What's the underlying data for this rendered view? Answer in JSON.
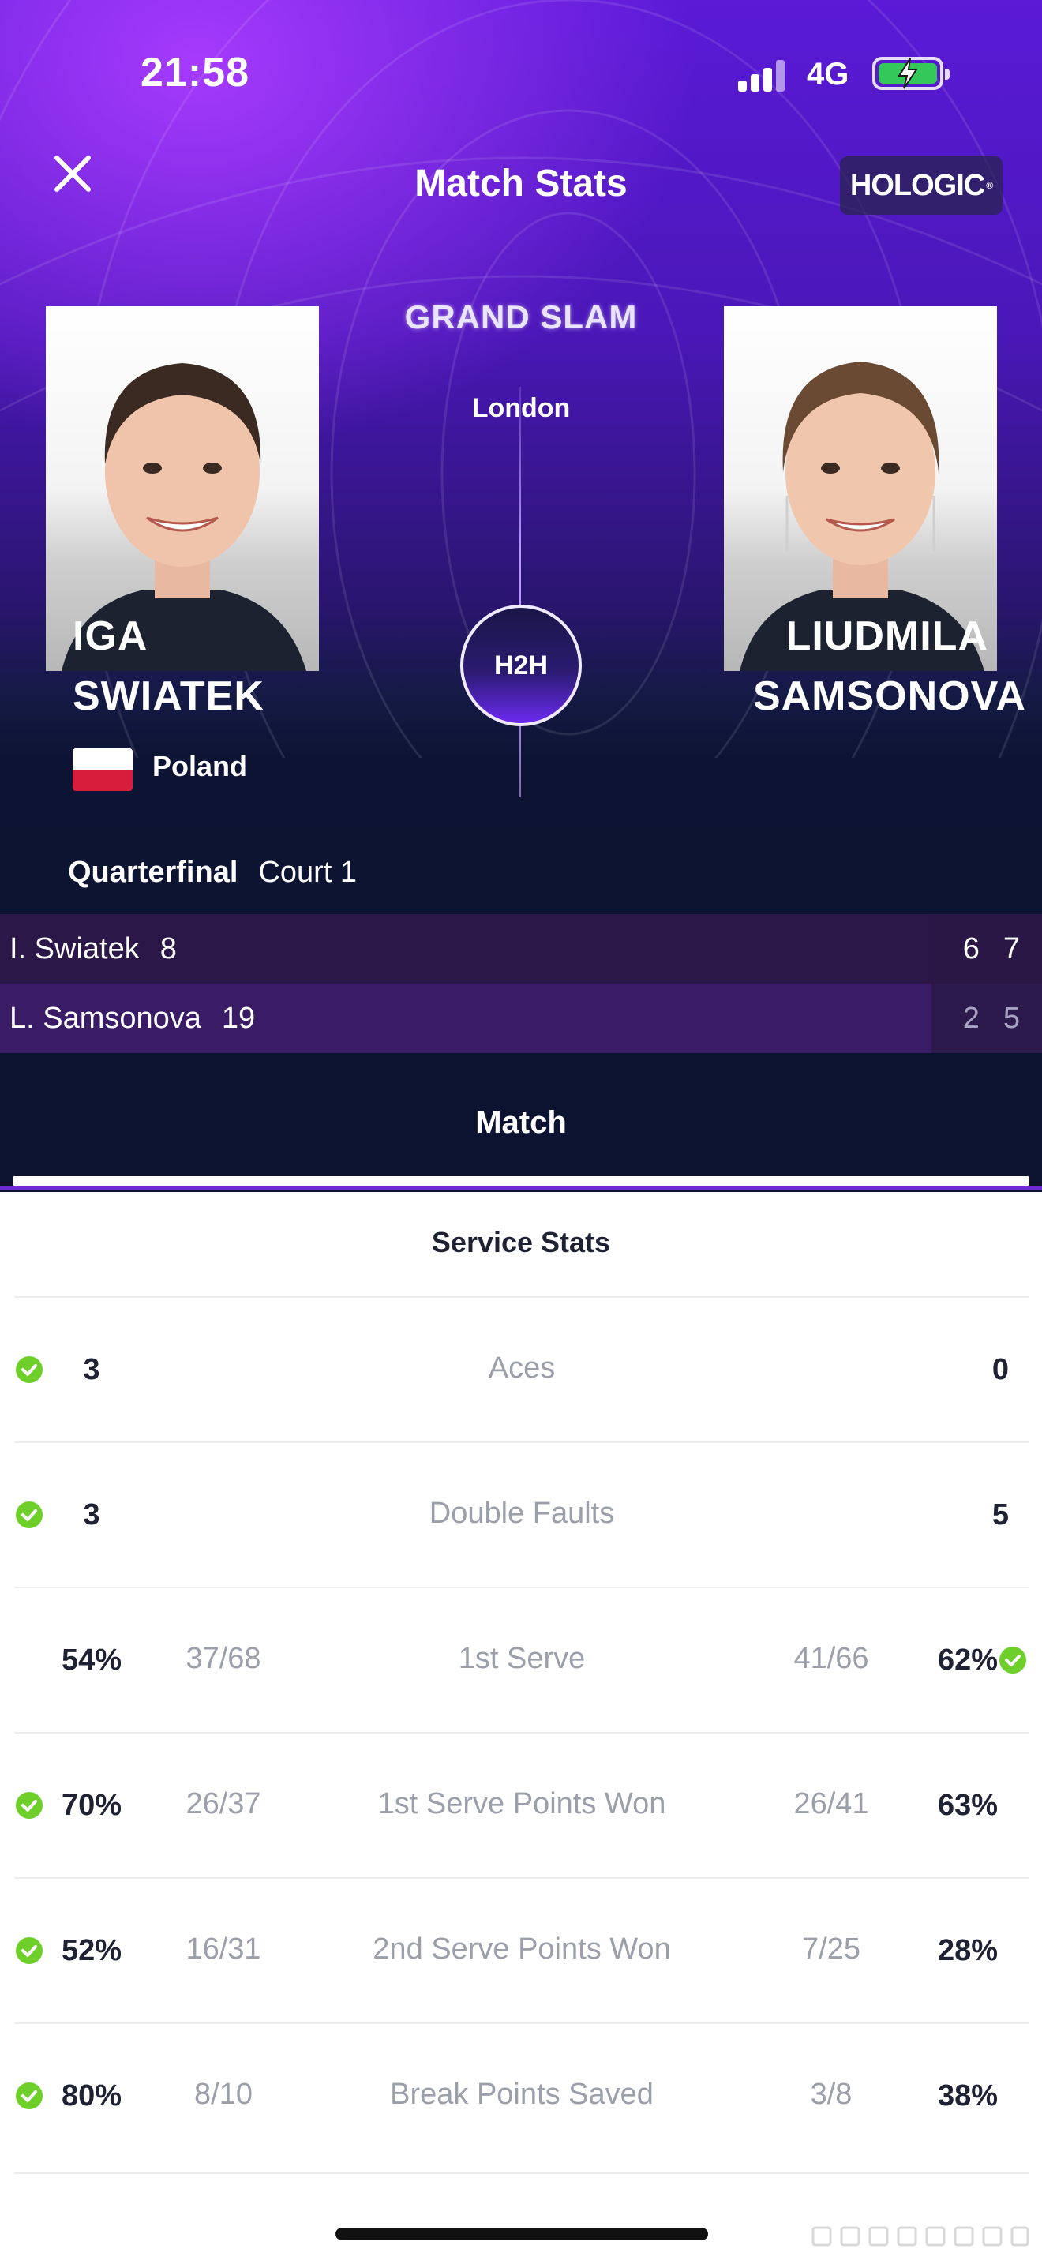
{
  "status_bar": {
    "time": "21:58",
    "network": "4G",
    "battery_icon": "battery-charging-icon",
    "colors": {
      "battery": "#34c759"
    }
  },
  "header": {
    "title": "Match Stats",
    "close_icon": "close-icon",
    "sponsor": "HOLOGIC"
  },
  "match": {
    "event": "GRAND SLAM",
    "city": "London",
    "h2h_label": "H2H",
    "round": "Quarterfinal",
    "court": "Court 1"
  },
  "players": {
    "left": {
      "first_name": "IGA",
      "last_name": "SWIATEK",
      "country": "Poland"
    },
    "right": {
      "first_name": "LIUDMILA",
      "last_name": "SAMSONOVA"
    }
  },
  "scoreboard": [
    {
      "player": "I. Swiatek",
      "seed": "8",
      "sets": [
        "6",
        "7"
      ]
    },
    {
      "player": "L. Samsonova",
      "seed": "19",
      "sets": [
        "2",
        "5"
      ]
    }
  ],
  "tabs": {
    "match": "Match"
  },
  "service_stats": {
    "title": "Service Stats",
    "rows": [
      {
        "label": "Aces",
        "left_value": "3",
        "left_fraction": "",
        "right_fraction": "",
        "right_value": "0",
        "leader": "left"
      },
      {
        "label": "Double Faults",
        "left_value": "3",
        "left_fraction": "",
        "right_fraction": "",
        "right_value": "5",
        "leader": "left"
      },
      {
        "label": "1st Serve",
        "left_value": "54%",
        "left_fraction": "37/68",
        "right_fraction": "41/66",
        "right_value": "62%",
        "leader": "right"
      },
      {
        "label": "1st Serve Points Won",
        "left_value": "70%",
        "left_fraction": "26/37",
        "right_fraction": "26/41",
        "right_value": "63%",
        "leader": "left"
      },
      {
        "label": "2nd Serve Points Won",
        "left_value": "52%",
        "left_fraction": "16/31",
        "right_fraction": "7/25",
        "right_value": "28%",
        "leader": "left"
      },
      {
        "label": "Break Points Saved",
        "left_value": "80%",
        "left_fraction": "8/10",
        "right_fraction": "3/8",
        "right_value": "38%",
        "leader": "left"
      }
    ]
  },
  "colors": {
    "accent_purple": "#6f2bd6",
    "leader_check": "#6fcf2a",
    "text_dark": "#1e2233",
    "text_muted": "#9b9faa"
  }
}
